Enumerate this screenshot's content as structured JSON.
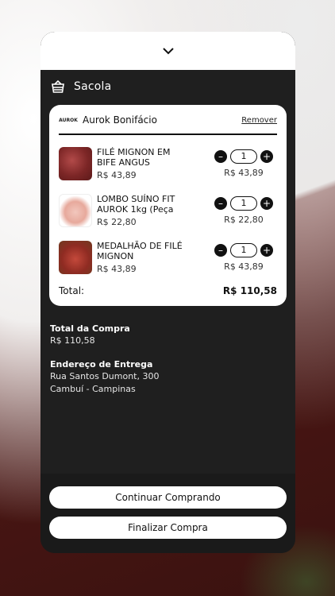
{
  "bag": {
    "title": "Sacola"
  },
  "store": {
    "name": "Aurok Bonifácio",
    "remove_label": "Remover",
    "logo_text": "AUROK"
  },
  "items": [
    {
      "name": "FILÉ MIGNON EM BIFE ANGUS",
      "price": "R$ 43,89",
      "qty": "1",
      "subtotal": "R$ 43,89",
      "thumb": "red1"
    },
    {
      "name": "LOMBO SUÍNO FIT AUROK 1kg (Peça",
      "price": "R$ 22,80",
      "qty": "1",
      "subtotal": "R$ 22,80",
      "thumb": "pink"
    },
    {
      "name": "MEDALHÃO DE FILÉ MIGNON",
      "price": "R$ 43,89",
      "qty": "1",
      "subtotal": "R$ 43,89",
      "thumb": "red2"
    }
  ],
  "cart_total": {
    "label": "Total:",
    "value": "R$ 110,58"
  },
  "summary": {
    "total_title": "Total da Compra",
    "total_value": "R$ 110,58",
    "address_title": "Endereço de Entrega",
    "address_line1": "Rua Santos Dumont, 300",
    "address_line2": "Cambuí - Campinas"
  },
  "buttons": {
    "continue": "Continuar Comprando",
    "finish": "Finalizar Compra"
  },
  "icons": {
    "collapse": "chevron-down-icon",
    "bag": "basket-icon",
    "minus": "minus-icon",
    "plus": "plus-icon"
  },
  "colors": {
    "sheet": "#1f1f1f",
    "card": "#ffffff",
    "accent": "#111111"
  }
}
